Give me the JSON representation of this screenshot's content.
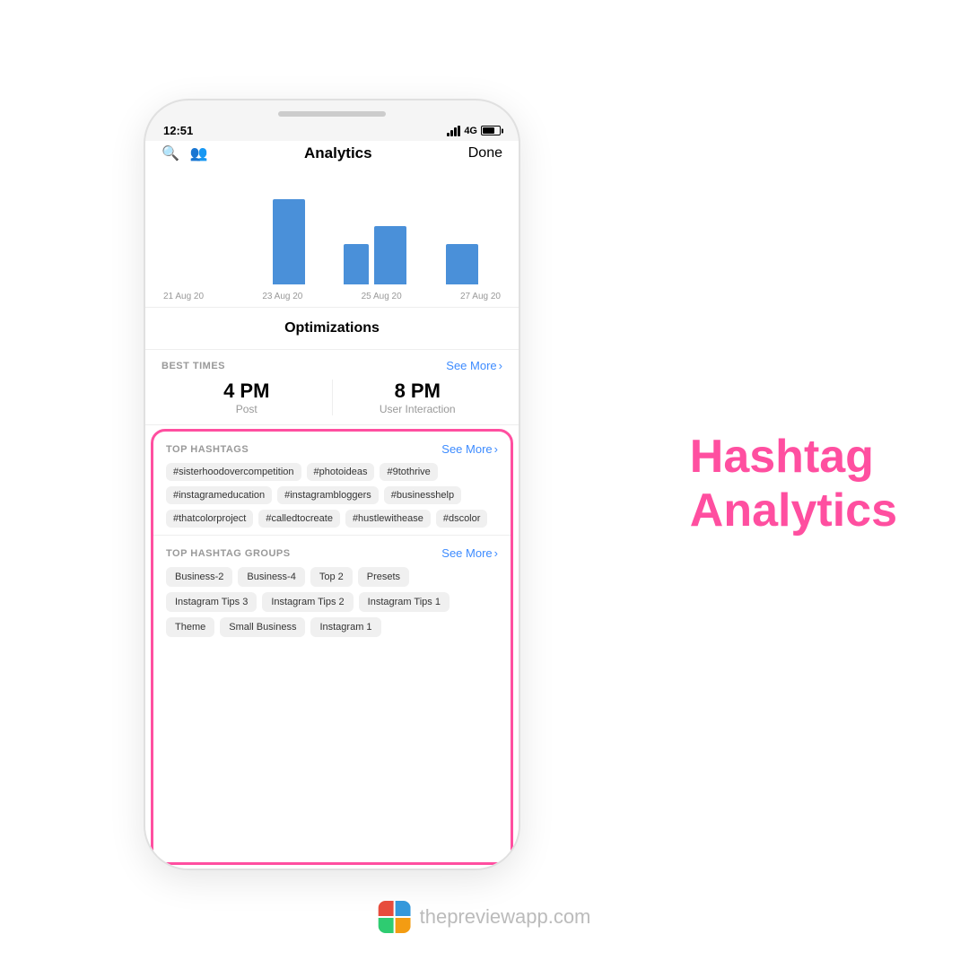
{
  "page": {
    "background": "#ffffff"
  },
  "status_bar": {
    "time": "12:51",
    "signal": "4G"
  },
  "header": {
    "title": "Analytics",
    "done_label": "Done"
  },
  "chart": {
    "labels": [
      "21 Aug 20",
      "23 Aug 20",
      "25 Aug 20",
      "27 Aug 20"
    ]
  },
  "optimizations": {
    "title": "Optimizations"
  },
  "best_times": {
    "label": "BEST TIMES",
    "see_more": "See More",
    "post_time": "4 PM",
    "post_label": "Post",
    "interaction_time": "8 PM",
    "interaction_label": "User Interaction"
  },
  "top_hashtags": {
    "label": "TOP HASHTAGS",
    "see_more": "See More",
    "tags": [
      "#sisterhoodovercompetition",
      "#photoideas",
      "#9tothrive",
      "#instagrameducation",
      "#instagrambloggers",
      "#businesshelp",
      "#thatcolorproject",
      "#calledtocreate",
      "#hustlewithease",
      "#dscolor"
    ]
  },
  "top_hashtag_groups": {
    "label": "TOP HASHTAG GROUPS",
    "see_more": "See More",
    "groups": [
      "Business-2",
      "Business-4",
      "Top 2",
      "Presets",
      "Instagram Tips 3",
      "Instagram Tips 2",
      "Instagram Tips 1",
      "Theme",
      "Small Business",
      "Instagram 1"
    ]
  },
  "right_heading": {
    "line1": "Hashtag",
    "line2": "Analytics"
  },
  "branding": {
    "url": "thepreviewapp.com"
  }
}
